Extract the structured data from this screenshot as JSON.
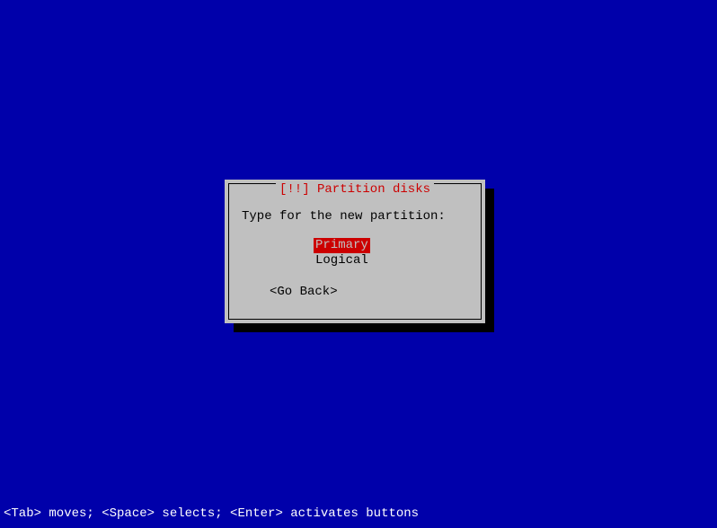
{
  "dialog": {
    "title": "[!!] Partition disks",
    "prompt": "Type for the new partition:",
    "options": {
      "primary": "Primary",
      "logical": "Logical"
    },
    "go_back": "<Go Back>"
  },
  "help_bar": "<Tab> moves; <Space> selects; <Enter> activates buttons"
}
